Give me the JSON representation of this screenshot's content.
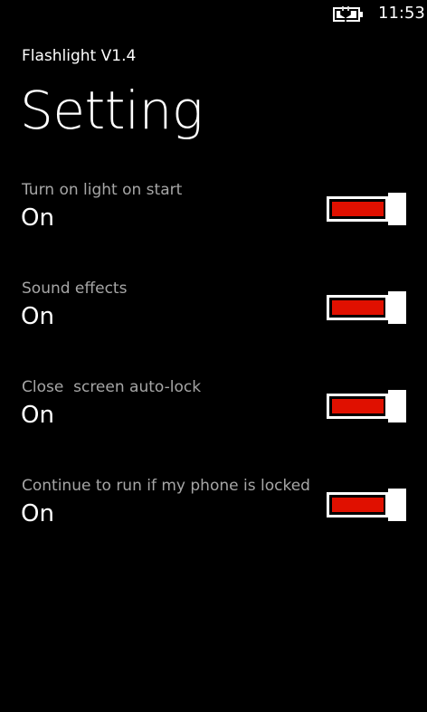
{
  "status_bar": {
    "battery_icon": "battery-charging-icon",
    "time": "11:53"
  },
  "header": {
    "app_title": "Flashlight V1.4",
    "page_title": "Setting"
  },
  "colors": {
    "background": "#000000",
    "label": "#a6a6a6",
    "value": "#ffffff",
    "toggle_fill_on": "#e01000",
    "toggle_border": "#ffffff"
  },
  "settings": [
    {
      "label": "Turn on light on start",
      "value": "On",
      "on": true
    },
    {
      "label": "Sound effects",
      "value": "On",
      "on": true
    },
    {
      "label": "Close  screen auto-lock",
      "value": "On",
      "on": true
    },
    {
      "label": "Continue to run if my phone is locked",
      "value": "On",
      "on": true
    }
  ]
}
